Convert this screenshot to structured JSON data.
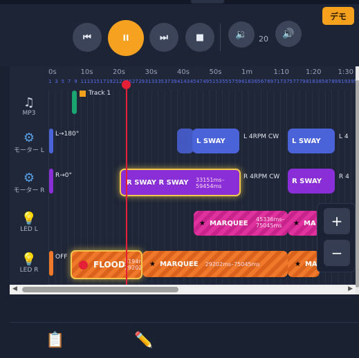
{
  "header": {
    "demo_label": "デモ"
  },
  "transport": {
    "prev_label": "⏮",
    "play_label": "II",
    "next_label": "⏭",
    "stop_label": "■",
    "vol_down_icon": "🔉",
    "volume_value": "20",
    "vol_up_icon": "🔊"
  },
  "ruler": {
    "ticks": [
      "0s",
      "10s",
      "20s",
      "30s",
      "40s",
      "50s",
      "1m",
      "1:10",
      "1:20",
      "1:30"
    ],
    "seconds": [
      "1",
      "3",
      "5",
      "7",
      "9",
      "11",
      "13",
      "15",
      "17",
      "19",
      "21",
      "23",
      "25",
      "27",
      "29",
      "31",
      "33",
      "35",
      "37",
      "39",
      "41",
      "43",
      "45",
      "47",
      "49",
      "51",
      "53",
      "55",
      "57",
      "59",
      "61",
      "63",
      "65",
      "67",
      "69",
      "71",
      "73",
      "75",
      "77",
      "79",
      "81",
      "83",
      "85",
      "87",
      "89",
      "91",
      "93",
      "95"
    ]
  },
  "rows": {
    "mp3": {
      "icon": "♫",
      "label": "MP3"
    },
    "motor_l": {
      "icon": "⚙",
      "label": "モーター L"
    },
    "motor_r": {
      "icon": "⚙",
      "label": "モーター R"
    },
    "led_l": {
      "icon": "💡",
      "label": "LED L"
    },
    "led_r": {
      "icon": "💡",
      "label": "LED R"
    }
  },
  "clips": {
    "track1": "Track 1",
    "motor_l_start": "L→180°",
    "l_sway_1": "L SWAY",
    "l_4rpm_1": "L 4RPM CW",
    "l_sway_2": "L SWAY",
    "l_4rpm_2": "L 4",
    "motor_r_start": "R→0°",
    "r_sway_main": "R SWAY R SWAY",
    "r_sway_time_a": "33151ms–",
    "r_sway_time_b": "59454ms",
    "r_4rpm_1": "R 4RPM CW",
    "r_sway_2": "R SWAY",
    "r_4rpm_2": "R 4",
    "marquee_l": "MARQUEE",
    "marquee_l_time_a": "45336ms–",
    "marquee_l_time_b": "75045ms",
    "marquee_l_2": "MA",
    "led_r_off": "OFF",
    "flood": "FLOOD",
    "flood_time_a": "3194m",
    "flood_time_b": "29202",
    "marquee_r": "MARQUEE",
    "marquee_r_time": "29202ms–75045ms",
    "marquee_r_2": "MA"
  },
  "zoom": {
    "in_label": "+",
    "out_label": "−"
  },
  "tabs": {
    "clipboard_icon": "📋",
    "pencil_icon": "✏️"
  },
  "colors": {
    "accent": "#f7a120",
    "playhead": "#e41f36",
    "motor_blue": "#4a63d9",
    "motor_purple": "#8a2fd7",
    "led_pink": "#e0329f",
    "led_orange": "#f0782a"
  }
}
